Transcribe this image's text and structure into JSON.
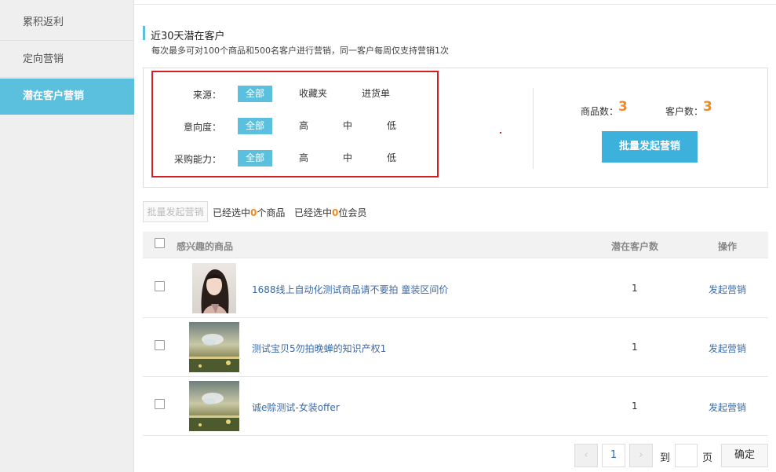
{
  "sidebar": {
    "items": [
      {
        "label": "累积返利"
      },
      {
        "label": "定向营销"
      },
      {
        "label": "潜在客户营销"
      }
    ]
  },
  "header": {
    "title": "近30天潜在客户",
    "subtitle": "每次最多可对100个商品和500名客户进行营销，同一客户每周仅支持营销1次"
  },
  "filters": {
    "source": {
      "label": "来源：",
      "options": [
        "全部",
        "收藏夹",
        "进货单"
      ],
      "selected": "全部"
    },
    "intent": {
      "label": "意向度：",
      "options": [
        "全部",
        "高",
        "中",
        "低"
      ],
      "selected": "全部"
    },
    "capacity": {
      "label": "采购能力：",
      "options": [
        "全部",
        "高",
        "中",
        "低"
      ],
      "selected": "全部"
    }
  },
  "stats": {
    "product_label": "商品数：",
    "product_count": "3",
    "customer_label": "客户数：",
    "customer_count": "3",
    "batch_button": "批量发起营销"
  },
  "selection": {
    "batch_button": "批量发起营销",
    "products_prefix": "已经选中",
    "products_count": "0",
    "products_suffix": "个商品",
    "members_prefix": "已经选中",
    "members_count": "0",
    "members_suffix": "位会员"
  },
  "table": {
    "columns": [
      "感兴趣的商品",
      "潜在客户数",
      "操作"
    ],
    "rows": [
      {
        "name": "1688线上自动化测试商品请不要拍 童装区间价",
        "count": "1",
        "action": "发起营销"
      },
      {
        "name": "测试宝贝5勿拍晚蝉的知识产权1",
        "count": "1",
        "action": "发起营销"
      },
      {
        "name": "诚e赊测试-女装offer",
        "count": "1",
        "action": "发起营销"
      }
    ]
  },
  "pagination": {
    "prev": "‹",
    "current": "1",
    "next": "›",
    "goto_label": "到",
    "page_label": "页",
    "confirm": "确定"
  },
  "colors": {
    "accent": "#5bc0de",
    "button": "#3bb1dc",
    "highlight_border": "#d32027",
    "number": "#f08a24",
    "link": "#3a6aa8"
  }
}
